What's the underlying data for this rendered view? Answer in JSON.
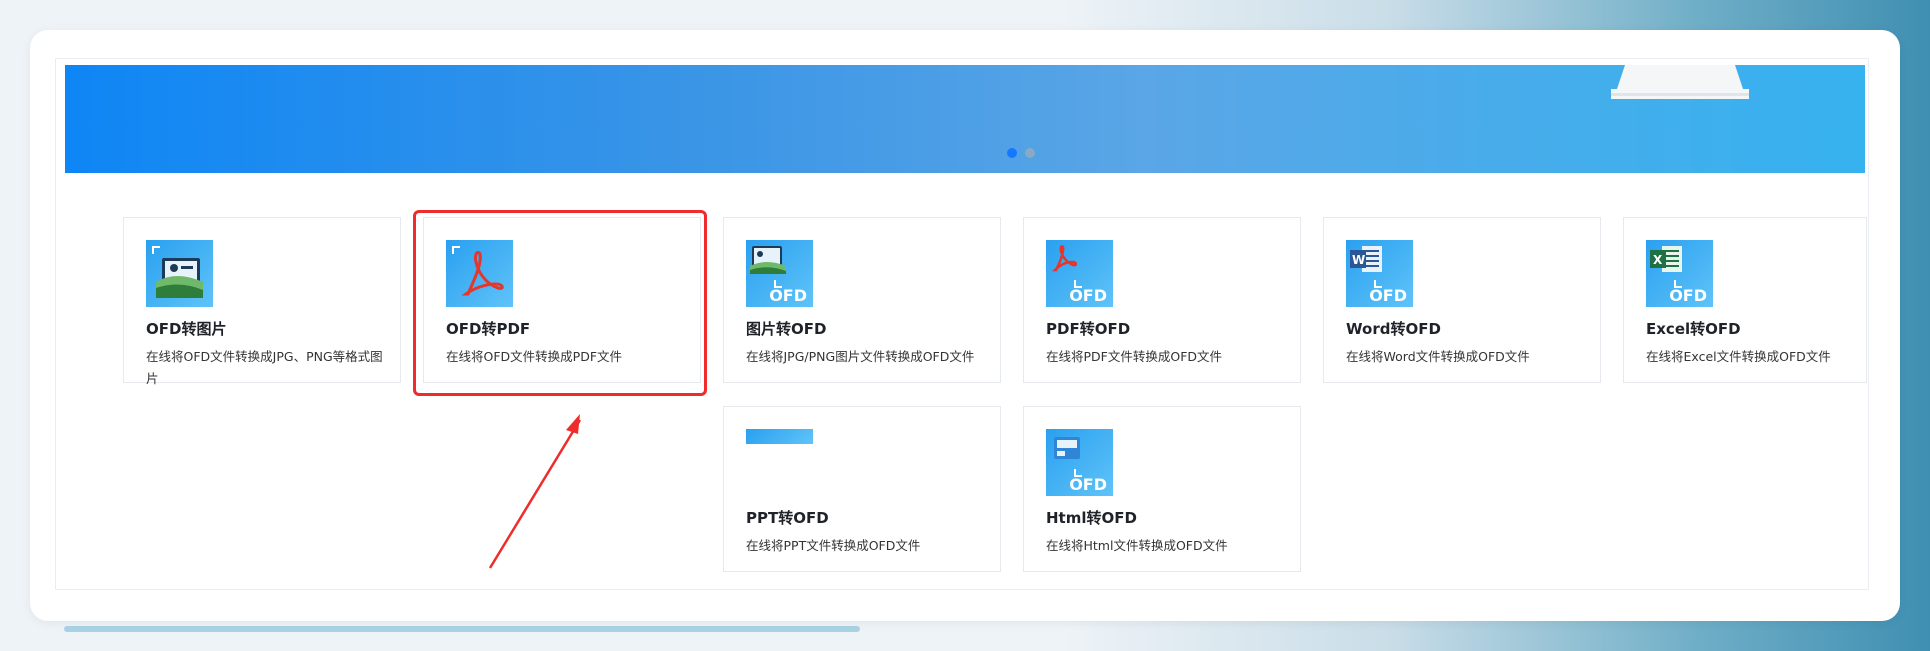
{
  "banner": {
    "slides": 2,
    "active_slide": 0
  },
  "colors": {
    "accent": "#1677ff",
    "banner_start": "#0e86f5",
    "banner_end": "#36b2ef",
    "highlight": "#ef2b2b"
  },
  "cards": [
    {
      "title": "OFD转图片",
      "desc": "在线将OFD文件转换成JPG、PNG等格式图片",
      "icon": "image-icon",
      "badge": ""
    },
    {
      "title": "OFD转PDF",
      "desc": "在线将OFD文件转换成PDF文件",
      "icon": "pdf-icon",
      "badge": ""
    },
    {
      "title": "图片转OFD",
      "desc": "在线将JPG/PNG图片文件转换成OFD文件",
      "icon": "image-icon",
      "badge": "OFD"
    },
    {
      "title": "PDF转OFD",
      "desc": "在线将PDF文件转换成OFD文件",
      "icon": "pdf-icon",
      "badge": "OFD"
    },
    {
      "title": "Word转OFD",
      "desc": "在线将Word文件转换成OFD文件",
      "icon": "word-icon",
      "badge": "OFD"
    },
    {
      "title": "Excel转OFD",
      "desc": "在线将Excel文件转换成OFD文件",
      "icon": "excel-icon",
      "badge": "OFD"
    },
    {
      "title": "PPT转OFD",
      "desc": "在线将PPT文件转换成OFD文件",
      "icon": "ppt-icon",
      "badge": ""
    },
    {
      "title": "Html转OFD",
      "desc": "在线将Html文件转换成OFD文件",
      "icon": "html-icon",
      "badge": "OFD"
    }
  ]
}
